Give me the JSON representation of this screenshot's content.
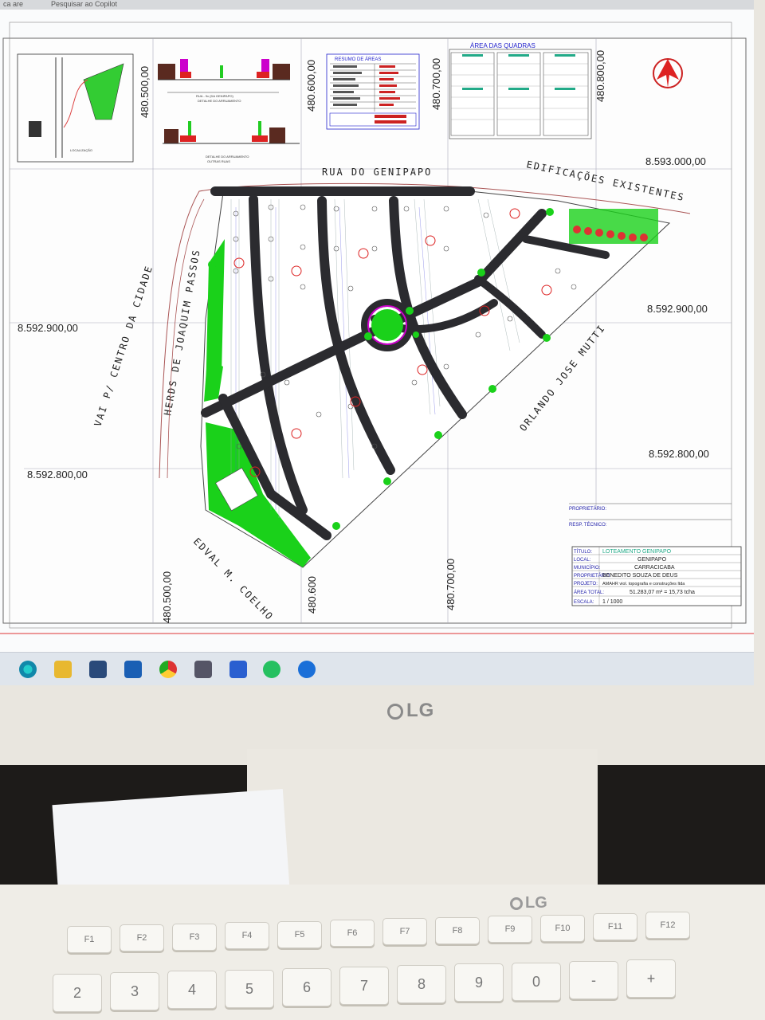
{
  "browser": {
    "tab_1": "ca are",
    "tab_2": "Pesquisar ao Copilot"
  },
  "plan": {
    "streets": {
      "north": "RUA DO GENIPAPO",
      "northeast": "EDIFICAÇÕES EXISTENTES",
      "east": "ORLANDO JOSE MUTTI",
      "west_1": "VAI P/ CENTRO DA CIDADE",
      "west_2": "HERDS DE JOAQUIM PASSOS",
      "southwest": "EDVAL M. COELHO"
    },
    "coords": {
      "top_x1": "480.500,00",
      "top_x2": "480.600,00",
      "top_x3": "480.700,00",
      "top_x4": "480.800,00",
      "bottom_x1": "480.500,00",
      "bottom_x2": "480.600",
      "bottom_x3": "480.700,00",
      "right_y1": "8.593.000,00",
      "right_y2": "8.592.900,00",
      "right_y3": "8.592.800,00",
      "left_y1": "8.592.900,00",
      "left_y2": "8.592.800,00"
    },
    "tables": {
      "areas_title": "RESUMO DE ÁREAS",
      "quadras_title": "ÁREA DAS QUADRAS"
    },
    "location_label": "LOCALIZAÇÃO",
    "section_1": "RUA - 9x (DA GENIPAPO)",
    "section_1_sub": "DETALHE DO ARRUAMENTO",
    "section_2": "DETALHE DO ARRUAMENTO",
    "section_2_sub": "OUTRAS RUAS",
    "title_block": {
      "proprietario_label": "PROPRIETÁRIO:",
      "resp_label": "RESP. TÉCNICO:",
      "titulo_label": "TÍTULO:",
      "titulo_value": "LOTEAMENTO GENIPAPO",
      "local_label": "LOCAL:",
      "local_value": "GENIPAPO",
      "municipio_label": "MUNICÍPIO:",
      "municipio_value": "CARRACICABA",
      "proprietario2_label": "PROPRIETÁRIO:",
      "proprietario2_value": "BENEDITO SOUZA DE DEUS",
      "projeto_label": "PROJETO:",
      "projeto_value": "AMAHR viol. topografia e construções ltda",
      "area_label": "ÁREA TOTAL:",
      "area_value": "51.283,07 m² = 15,73 tcha",
      "escala_label": "ESCALA:",
      "escala_value": "1 / 1000"
    }
  },
  "monitor": {
    "brand": "LG"
  },
  "keyboard": {
    "brand": "LG",
    "fkeys": [
      "F1",
      "F2",
      "F3",
      "F4",
      "F5",
      "F6",
      "F7",
      "F8",
      "F9",
      "F10",
      "F11",
      "F12"
    ],
    "numkeys": [
      "2",
      "3",
      "4",
      "5",
      "6",
      "7",
      "8",
      "9",
      "0",
      "-",
      "+"
    ]
  },
  "colors": {
    "road": "#2b2b2f",
    "green": "#1ad11a",
    "cad_bg": "#fafbfc",
    "accent_red": "#e02020"
  }
}
